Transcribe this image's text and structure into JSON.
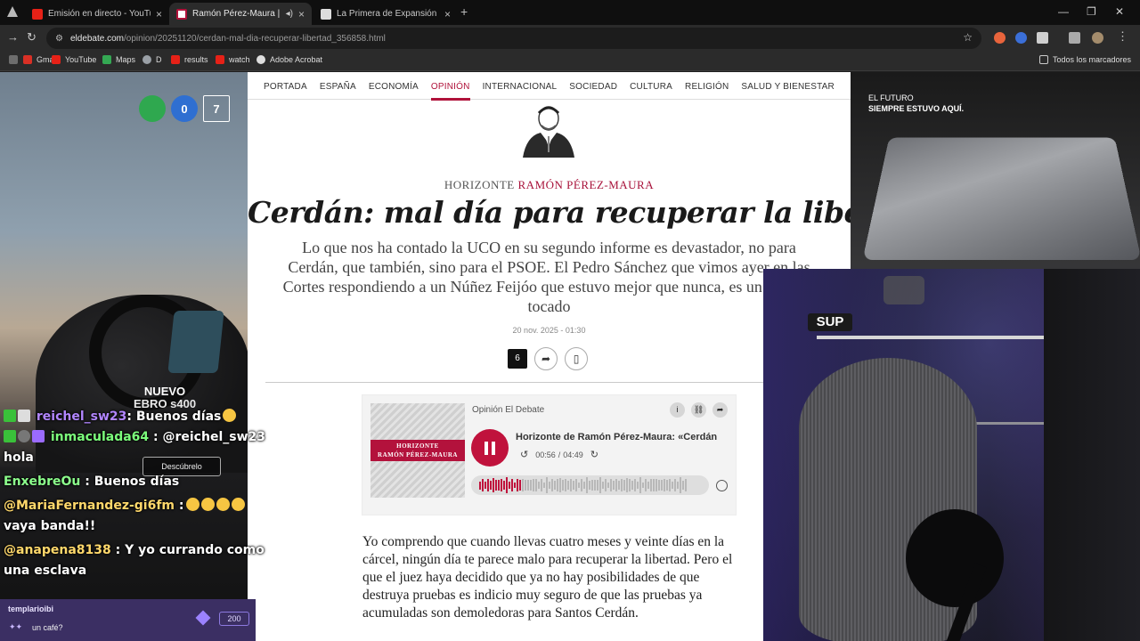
{
  "browser": {
    "tabs": [
      {
        "title": "Emisión en directo - YouTube Studio",
        "icon": "youtube-icon",
        "active": false
      },
      {
        "title": "Ramón Pérez-Maura | Cerdán: mal día",
        "icon": "el-debate-icon",
        "active": true
      },
      {
        "title": "La Primera de Expansión sobre",
        "icon": "expansion-icon",
        "active": false
      }
    ],
    "new_tab": "+",
    "url_host": "eldebate.com",
    "url_path": "/opinion/20251120/cerdan-mal-dia-recuperar-libertad_356858.html",
    "bookmarks": [
      {
        "label": "Gmail",
        "icon": "gmail-icon"
      },
      {
        "label": "YouTube",
        "icon": "youtube-icon"
      },
      {
        "label": "Maps",
        "icon": "maps-icon"
      },
      {
        "label": "D",
        "icon": "globe-icon"
      },
      {
        "label": "results",
        "icon": "youtube-icon"
      },
      {
        "label": "watch",
        "icon": "youtube-icon"
      },
      {
        "label": "Adobe Acrobat",
        "icon": "acrobat-icon"
      }
    ],
    "all_bookmarks": "Todos los marcadores"
  },
  "site_nav": [
    "PORTADA",
    "ESPAÑA",
    "ECONOMÍA",
    "OPINIÓN",
    "INTERNACIONAL",
    "SOCIEDAD",
    "CULTURA",
    "RELIGIÓN",
    "SALUD Y BIENESTAR"
  ],
  "article": {
    "section": "HORIZONTE",
    "author": "RAMÓN PÉREZ-MAURA",
    "headline": "Cerdán: mal día para recuperar la libertad",
    "standfirst": "Lo que nos ha contado la UCO en su segundo informe es devastador, no para Cerdán, que también, sino para el PSOE. El Pedro Sánchez que vimos ayer en las Cortes respondiendo a un Núñez Feijóo que estuvo mejor que nunca, es un hombre tocado",
    "date": "20 nov. 2025 - 01:30",
    "comments": "6",
    "body": "Yo comprendo que cuando llevas cuatro meses y veinte días en la cárcel, ningún día te parece malo para recuperar la libertad. Pero el que el juez haya decidido que ya no hay posibilidades de que destruya pruebas es indicio muy seguro de que las pruebas ya acumuladas son demoledoras para Santos Cerdán."
  },
  "player": {
    "show": "Opinión El Debate",
    "cover_line1": "HORIZONTE",
    "cover_line2": "RAMÓN PÉREZ-MAURA",
    "episode": "Horizonte de Ramón Pérez-Maura: «Cerdán",
    "current_time": "00:56",
    "separator": "/",
    "duration": "04:49",
    "progress": 0.2
  },
  "ad_left": {
    "badge1": "",
    "badge2": "0",
    "badge3": "7",
    "nuevo": "NUEVO",
    "model": "EBRO s400",
    "cta": "Descúbrelo"
  },
  "ad_right": {
    "line1": "EL FUTURO",
    "line2": "SIEMPRE ESTUVO AQUÍ."
  },
  "chat": {
    "messages": [
      {
        "user": "reichel_sw23",
        "color": "#b286ff",
        "text": ": Buenos días"
      },
      {
        "user": "inmaculada64",
        "color": "#7cff7c",
        "text": ": @reichel_sw23"
      },
      {
        "user": "",
        "color": "#ffffff",
        "text": "hola"
      },
      {
        "user": "EnxebreOu",
        "color": "#8cff8c",
        "text": ": Buenos días"
      },
      {
        "user": "@MariaFernandez-gi6fm",
        "color": "#ffd86b",
        "text": ":"
      },
      {
        "user": "",
        "color": "#ffffff",
        "text": "vaya banda!!"
      },
      {
        "user": "@anapena8138",
        "color": "#ffd86b",
        "text": ": Y yo currando como"
      },
      {
        "user": "",
        "color": "#ffffff",
        "text": "una esclava"
      }
    ],
    "panel_user": "templarioibi",
    "panel_msg": "un café?",
    "bits": "200"
  },
  "colors": {
    "brand": "#b0123a",
    "player_accent": "#c0123c"
  }
}
